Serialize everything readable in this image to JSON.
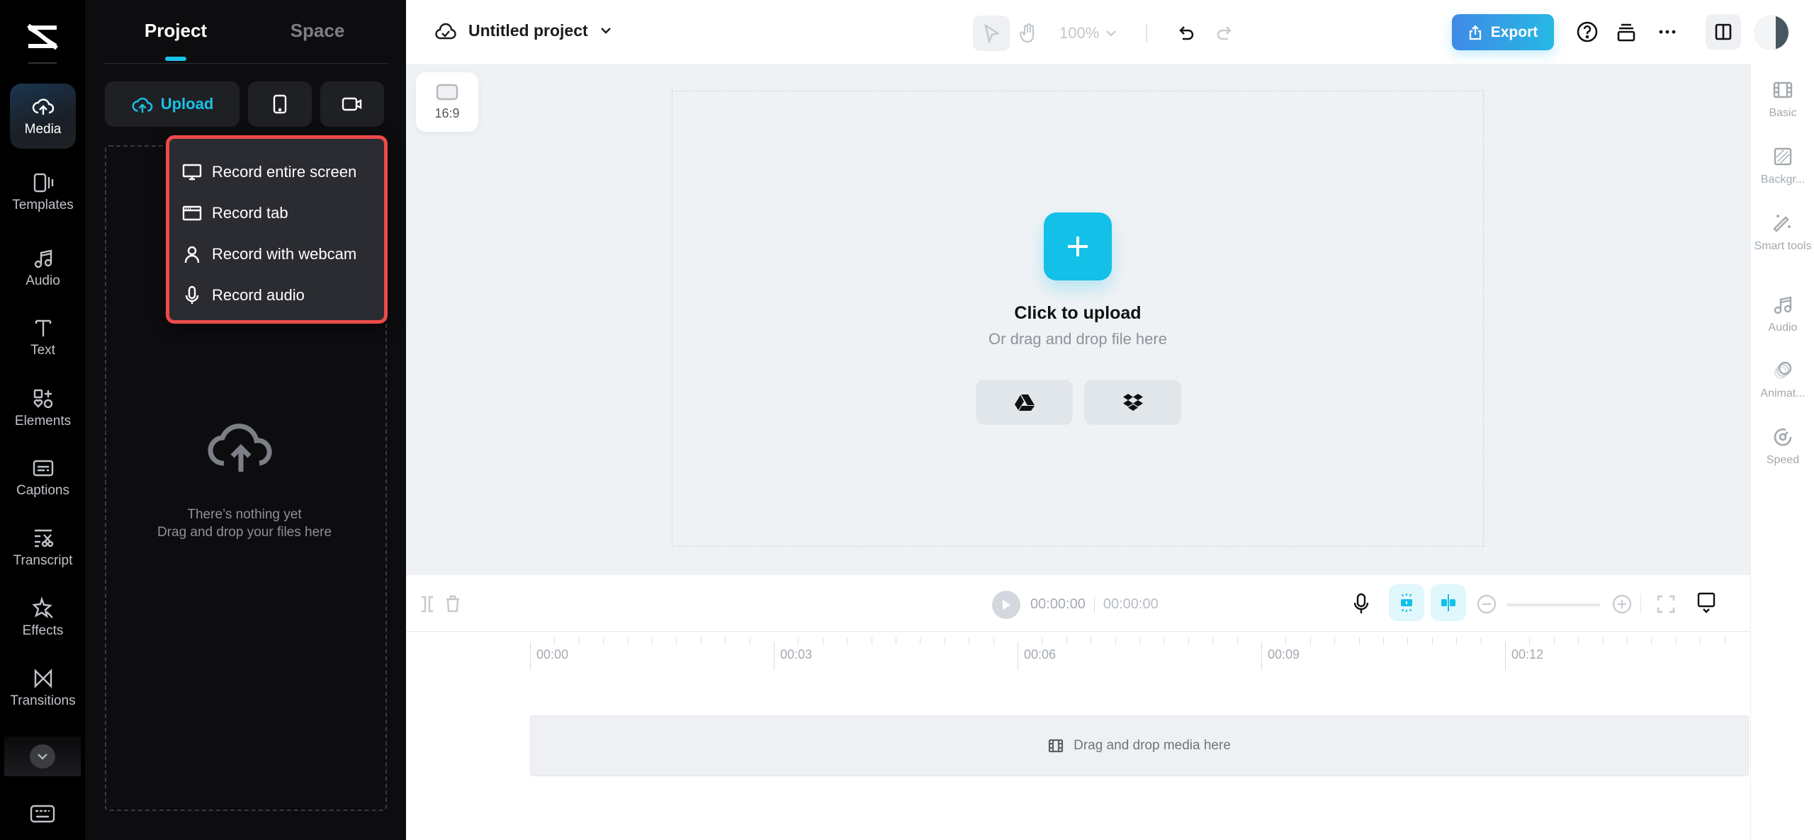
{
  "app": {
    "brand": "CapCut",
    "accent_color": "#19c2e6",
    "highlight_color": "#ee4a4a"
  },
  "rail": {
    "items": [
      {
        "label": "Media",
        "icon": "cloud-upload-icon",
        "active": true
      },
      {
        "label": "Templates",
        "icon": "templates-icon"
      },
      {
        "label": "Audio",
        "icon": "music-note-icon"
      },
      {
        "label": "Text",
        "icon": "text-icon"
      },
      {
        "label": "Elements",
        "icon": "elements-icon"
      },
      {
        "label": "Captions",
        "icon": "captions-icon"
      },
      {
        "label": "Transcript",
        "icon": "transcript-icon"
      },
      {
        "label": "Effects",
        "icon": "effects-icon"
      },
      {
        "label": "Transitions",
        "icon": "transitions-icon"
      }
    ],
    "more_icon": "chevron-down-icon",
    "shortcuts_icon": "keyboard-icon"
  },
  "panel": {
    "tabs": [
      {
        "label": "Project",
        "active": true
      },
      {
        "label": "Space",
        "active": false
      }
    ],
    "upload_label": "Upload",
    "phone_icon": "phone-icon",
    "record_icon": "video-camera-icon",
    "empty_line1": "There’s nothing yet",
    "empty_line2": "Drag and drop your files here"
  },
  "record_menu": {
    "items": [
      {
        "label": "Record entire screen",
        "icon": "monitor-icon"
      },
      {
        "label": "Record tab",
        "icon": "browser-tab-icon"
      },
      {
        "label": "Record with webcam",
        "icon": "person-icon"
      },
      {
        "label": "Record audio",
        "icon": "microphone-icon"
      }
    ]
  },
  "header": {
    "project_title": "Untitled project",
    "zoom": "100%",
    "export_label": "Export"
  },
  "stage": {
    "aspect_ratio": "16:9",
    "upload_title": "Click to upload",
    "upload_subtitle": "Or drag and drop file here",
    "sources": [
      "google-drive",
      "dropbox"
    ]
  },
  "properties": {
    "items": [
      {
        "label": "Basic"
      },
      {
        "label": "Backgr..."
      },
      {
        "label": "Smart tools"
      },
      {
        "label": "Audio"
      },
      {
        "label": "Animat..."
      },
      {
        "label": "Speed"
      }
    ]
  },
  "timeline": {
    "current_time": "00:00:00",
    "total_time": "00:00:00",
    "ruler_labels": [
      "00:00",
      "00:03",
      "00:06",
      "00:09",
      "00:12"
    ],
    "drop_hint": "Drag and drop media here"
  }
}
